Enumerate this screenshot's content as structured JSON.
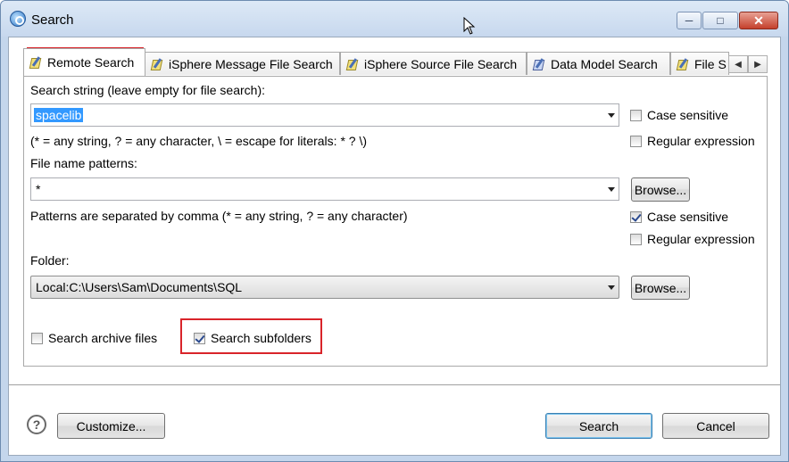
{
  "window": {
    "title": "Search"
  },
  "tabs": [
    {
      "label": "Remote Search",
      "active": true
    },
    {
      "label": "iSphere Message File Search"
    },
    {
      "label": "iSphere Source File Search"
    },
    {
      "label": "Data Model Search"
    },
    {
      "label": "File S"
    }
  ],
  "search": {
    "label": "Search string (leave empty for file search):",
    "value": "spacelib",
    "hint": "(* = any string, ? = any character, \\ = escape for literals: * ? \\)",
    "case_sensitive": {
      "label": "Case sensitive",
      "checked": false
    },
    "regex": {
      "label": "Regular expression",
      "checked": false
    }
  },
  "file_patterns": {
    "label": "File name patterns:",
    "value": "*",
    "browse_label": "Browse...",
    "hint": "Patterns are separated by comma (* = any string, ? = any character)",
    "case_sensitive": {
      "label": "Case sensitive",
      "checked": true
    },
    "regex": {
      "label": "Regular expression",
      "checked": false
    }
  },
  "folder": {
    "label": "Folder:",
    "value": "Local:C:\\Users\\Sam\\Documents\\SQL",
    "browse_label": "Browse..."
  },
  "options": {
    "archive": {
      "label": "Search archive files",
      "checked": false
    },
    "subfolders": {
      "label": "Search subfolders",
      "checked": true
    }
  },
  "footer": {
    "help_symbol": "?",
    "customize_label": "Customize...",
    "search_label": "Search",
    "cancel_label": "Cancel"
  },
  "colors": {
    "highlight": "#d9242a",
    "selection": "#3399ff",
    "title_bg": "#c7d8ee"
  },
  "icons": [
    "app-icon",
    "tab-search-icon",
    "data-model-icon",
    "help-icon",
    "minimize-icon",
    "maximize-icon",
    "close-icon"
  ]
}
